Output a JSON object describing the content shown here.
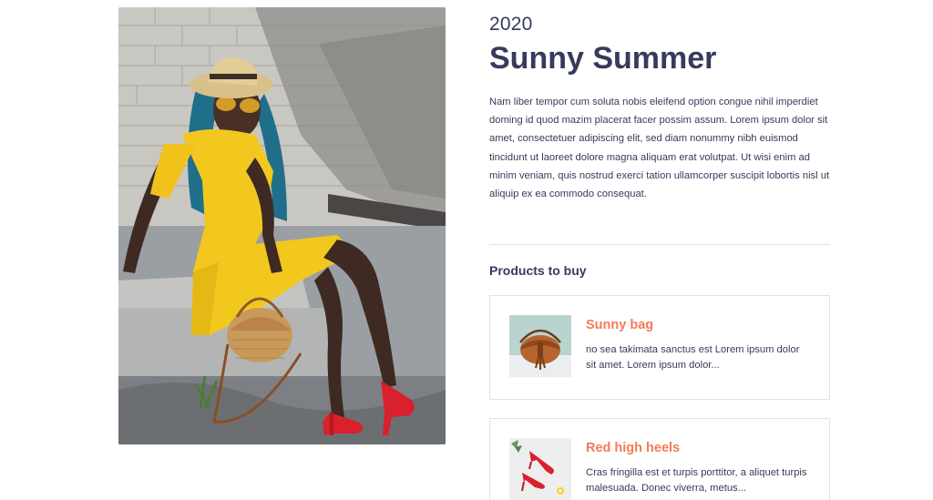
{
  "article": {
    "year": "2020",
    "title": "Sunny Summer",
    "description": "Nam liber tempor cum soluta nobis eleifend option congue nihil imperdiet doming id quod mazim placerat facer possim assum. Lorem ipsum dolor sit amet, consectetuer adipiscing elit, sed diam nonummy nibh euismod tincidunt ut laoreet dolore magna aliquam erat volutpat. Ut wisi enim ad minim veniam, quis nostrud exerci tation ullamcorper suscipit lobortis nisl ut aliquip ex ea commodo consequat."
  },
  "products": {
    "heading": "Products to buy",
    "items": [
      {
        "name": "Sunny bag",
        "description": "no sea takimata sanctus est Lorem ipsum dolor sit amet. Lorem ipsum dolor..."
      },
      {
        "name": "Red high heels",
        "description": "Cras fringilla est et turpis porttitor, a aliquet turpis malesuada. Donec viverra, metus..."
      }
    ]
  },
  "colors": {
    "text": "#363a5b",
    "accent": "#f47b55",
    "border": "#e2e2e6",
    "dress": "#f2c81e",
    "shoes": "#d9202c"
  }
}
